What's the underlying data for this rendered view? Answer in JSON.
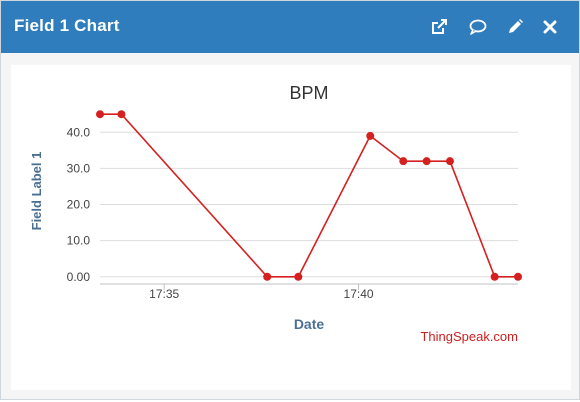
{
  "widget": {
    "title": "Field 1 Chart",
    "toolbar": {
      "open_icon": "external-link-icon",
      "comment_icon": "comment-icon",
      "edit_icon": "pencil-icon",
      "close_icon": "close-icon"
    },
    "header_color": "#2f7dbd"
  },
  "credit": "ThingSpeak.com",
  "chart_data": {
    "type": "line",
    "title": "BPM",
    "xlabel": "Date",
    "ylabel": "Field Label 1",
    "y_ticks": [
      "0.00",
      "10.0",
      "20.0",
      "30.0",
      "40.0"
    ],
    "ylim": [
      -2,
      47
    ],
    "x_ticks": [
      "17:35",
      "17:40"
    ],
    "x_tick_minutes": [
      35,
      40
    ],
    "xlim_minutes": [
      33.35,
      44.1
    ],
    "grid": true,
    "series": [
      {
        "color": "#d62020",
        "x_minutes": [
          33.35,
          33.9,
          37.65,
          38.45,
          40.3,
          41.15,
          41.75,
          42.35,
          43.5,
          44.1
        ],
        "values": [
          45,
          45,
          0,
          0,
          39,
          32,
          32,
          32,
          0,
          0
        ]
      }
    ]
  }
}
